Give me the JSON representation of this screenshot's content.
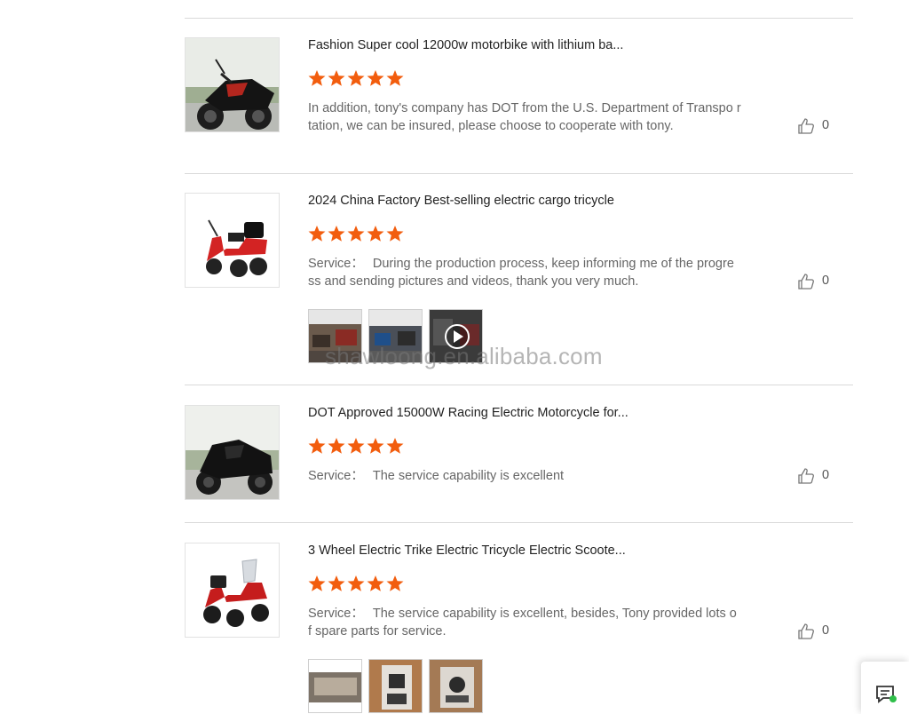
{
  "reviews": [
    {
      "title": "Fashion Super cool 12000w motorbike with lithium ba...",
      "rating": 5,
      "label": "",
      "comment": "In addition, tony's company has DOT from the U.S. Department of Transpo rtation, we can be insured, please choose to cooperate with tony.",
      "likes": "0",
      "photos": []
    },
    {
      "title": "2024 China Factory Best-selling electric cargo tricycle",
      "rating": 5,
      "label": "Service：",
      "comment": "During the production process, keep informing me of the progre ss and sending pictures and videos, thank you very much.",
      "likes": "0",
      "photos": [
        "photo-1",
        "photo-2",
        "video-3"
      ]
    },
    {
      "title": "DOT Approved 15000W Racing Electric Motorcycle for...",
      "rating": 5,
      "label": "Service：",
      "comment": "The service capability is excellent",
      "likes": "0",
      "photos": []
    },
    {
      "title": "3 Wheel Electric Trike Electric Tricycle Electric Scoote...",
      "rating": 5,
      "label": "Service：",
      "comment": "The service capability is excellent, besides, Tony provided lots o f spare parts for service.",
      "likes": "0",
      "photos": [
        "photo-1",
        "photo-2",
        "photo-3"
      ]
    }
  ],
  "watermark": "shawloong.en.alibaba.com",
  "colors": {
    "star": "#f25d0e",
    "divider": "#d9d9d9",
    "chat_dot": "#2fbf4a"
  },
  "icons": {
    "star": "star-icon",
    "like": "thumbs-up-icon",
    "chat": "chat-icon",
    "play": "play-icon"
  }
}
